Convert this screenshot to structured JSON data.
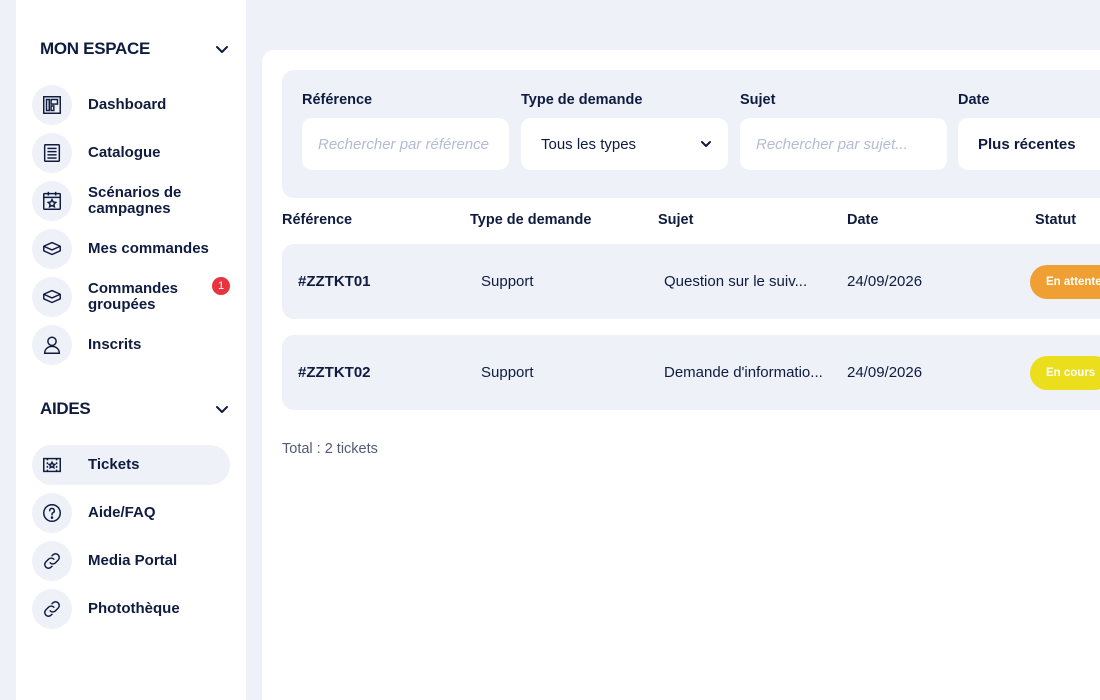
{
  "sidebar": {
    "sections": [
      {
        "title": "MON ESPACE",
        "items": [
          {
            "label": "Dashboard",
            "icon": "dashboard-icon"
          },
          {
            "label": "Catalogue",
            "icon": "catalogue-icon"
          },
          {
            "label": "Scénarios de campagnes",
            "icon": "campaign-scenario-icon"
          },
          {
            "label": "Mes commandes",
            "icon": "box-icon"
          },
          {
            "label": "Commandes groupées",
            "icon": "box-icon",
            "badge": "1"
          },
          {
            "label": "Inscrits",
            "icon": "user-icon"
          }
        ]
      },
      {
        "title": "AIDES",
        "items": [
          {
            "label": "Tickets",
            "icon": "ticket-icon",
            "active": true
          },
          {
            "label": "Aide/FAQ",
            "icon": "help-icon"
          },
          {
            "label": "Media Portal",
            "icon": "link-icon"
          },
          {
            "label": "Photothèque",
            "icon": "link-icon"
          }
        ]
      }
    ]
  },
  "filters": {
    "reference": {
      "label": "Référence",
      "placeholder": "Rechercher par référence"
    },
    "type": {
      "label": "Type de demande",
      "value": "Tous les types"
    },
    "subject": {
      "label": "Sujet",
      "placeholder": "Rechercher par sujet..."
    },
    "date": {
      "label": "Date",
      "value": "Plus récentes"
    }
  },
  "table": {
    "columns": [
      "Référence",
      "Type de demande",
      "Sujet",
      "Date",
      "Statut"
    ],
    "rows": [
      {
        "reference": "#ZZTKT01",
        "type": "Support",
        "subject": "Question sur le suiv...",
        "date": "24/09/2026",
        "status": "En attente"
      },
      {
        "reference": "#ZZTKT02",
        "type": "Support",
        "subject": "Demande d'informatio...",
        "date": "24/09/2026",
        "status": "En cours"
      }
    ]
  },
  "total": "Total : 2 tickets",
  "colors": {
    "navy": "#0f1c3f",
    "background": "#eef1f8",
    "status_waiting": "#f0a033",
    "status_in_progress": "#ebde1c",
    "badge": "#e8343f"
  }
}
